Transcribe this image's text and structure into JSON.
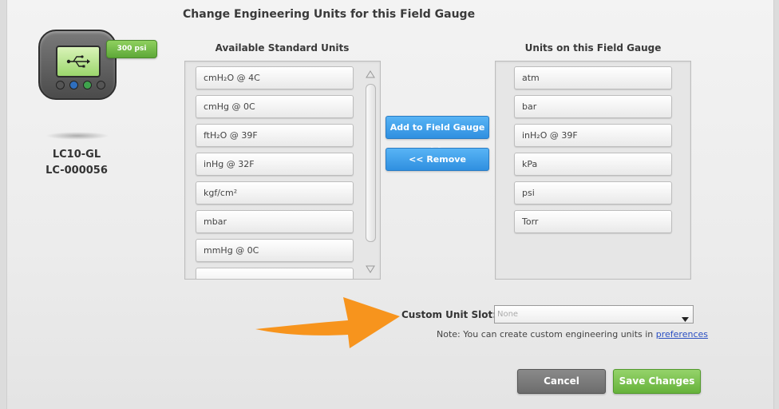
{
  "page": {
    "title": "Change Engineering Units for this Field Gauge"
  },
  "device": {
    "badge": "300 psi",
    "model": "LC10-GL",
    "serial": "LC-000056",
    "screen_icon": "usb-icon"
  },
  "available": {
    "header": "Available Standard Units",
    "items": [
      "cmH₂O @ 4C",
      "cmHg @ 0C",
      "ftH₂O @ 39F",
      "inHg @ 32F",
      "kgf/cm²",
      "mbar",
      "mmHg @ 0C",
      ""
    ]
  },
  "gauge_units": {
    "header": "Units on this Field Gauge",
    "items": [
      "atm",
      "bar",
      "inH₂O @ 39F",
      "kPa",
      "psi",
      "Torr"
    ]
  },
  "actions": {
    "add_label": "Add to Field Gauge >>",
    "remove_label": "<< Remove"
  },
  "custom": {
    "label": "Custom Unit Slot:",
    "value": "None",
    "note": "Note: You can create custom engineering units in ",
    "link": "preferences"
  },
  "footer": {
    "cancel_label": "Cancel",
    "save_label": "Save Changes"
  },
  "colors": {
    "accent_blue": "#3a9ae8",
    "save_green": "#7cc350",
    "annotation_orange": "#f7941d"
  }
}
